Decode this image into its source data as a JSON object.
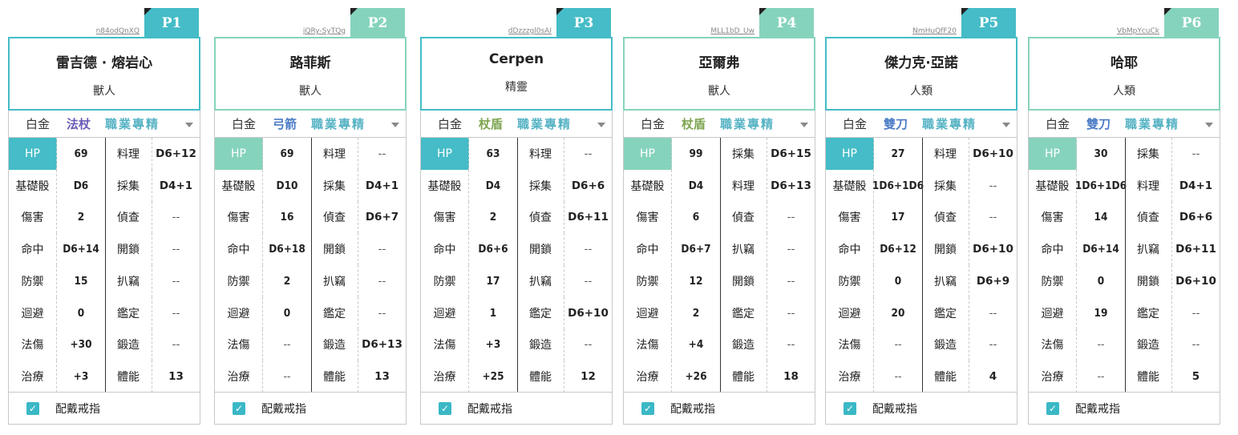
{
  "colors": {
    "teal": "#45bcc7",
    "mint": "#86d3bd",
    "purple": "#6a5ab6",
    "blue": "#4b7bc6",
    "olive": "#7da44e",
    "prof": "#56b3c4"
  },
  "ring_label": "配戴戒指",
  "players": [
    {
      "tab": "P1",
      "code": "n84odQnXQ",
      "name": "雷吉德 · 熔岩心",
      "race": "獸人",
      "tier": "白金",
      "weapon": "法杖",
      "weapon_color": "purple",
      "profession": "職業專精",
      "accent": "teal",
      "stats": [
        {
          "label": "HP",
          "value": "69"
        },
        {
          "label": "基礎骰",
          "value": "D6"
        },
        {
          "label": "傷害",
          "value": "2"
        },
        {
          "label": "命中",
          "value": "D6+14"
        },
        {
          "label": "防禦",
          "value": "15"
        },
        {
          "label": "迴避",
          "value": "0"
        },
        {
          "label": "法傷",
          "value": "+30"
        },
        {
          "label": "治療",
          "value": "+3"
        }
      ],
      "skills": [
        {
          "label": "料理",
          "value": "D6+12"
        },
        {
          "label": "採集",
          "value": "D4+1"
        },
        {
          "label": "偵查",
          "value": "--"
        },
        {
          "label": "開鎖",
          "value": "--"
        },
        {
          "label": "扒竊",
          "value": "--"
        },
        {
          "label": "鑑定",
          "value": "--"
        },
        {
          "label": "鍛造",
          "value": "--"
        },
        {
          "label": "體能",
          "value": "13"
        }
      ]
    },
    {
      "tab": "P2",
      "code": "jQRy-SyTQg",
      "name": "路菲斯",
      "race": "獸人",
      "tier": "白金",
      "weapon": "弓箭",
      "weapon_color": "blue",
      "profession": "職業專精",
      "accent": "mint",
      "stats": [
        {
          "label": "HP",
          "value": "69"
        },
        {
          "label": "基礎骰",
          "value": "D10"
        },
        {
          "label": "傷害",
          "value": "16"
        },
        {
          "label": "命中",
          "value": "D6+18"
        },
        {
          "label": "防禦",
          "value": "2"
        },
        {
          "label": "迴避",
          "value": "0"
        },
        {
          "label": "法傷",
          "value": "--"
        },
        {
          "label": "治療",
          "value": "--"
        }
      ],
      "skills": [
        {
          "label": "料理",
          "value": "--"
        },
        {
          "label": "採集",
          "value": "D4+1"
        },
        {
          "label": "偵查",
          "value": "D6+7"
        },
        {
          "label": "開鎖",
          "value": "--"
        },
        {
          "label": "扒竊",
          "value": "--"
        },
        {
          "label": "鑑定",
          "value": "--"
        },
        {
          "label": "鍛造",
          "value": "D6+13"
        },
        {
          "label": "體能",
          "value": "13"
        }
      ]
    },
    {
      "tab": "P3",
      "code": "dDzzzgl0sAI",
      "name": "Cerpen",
      "race": "精靈",
      "tier": "白金",
      "weapon": "杖盾",
      "weapon_color": "olive",
      "profession": "職業專精",
      "accent": "teal",
      "stats": [
        {
          "label": "HP",
          "value": "63"
        },
        {
          "label": "基礎骰",
          "value": "D4"
        },
        {
          "label": "傷害",
          "value": "2"
        },
        {
          "label": "命中",
          "value": "D6+6"
        },
        {
          "label": "防禦",
          "value": "17"
        },
        {
          "label": "迴避",
          "value": "1"
        },
        {
          "label": "法傷",
          "value": "+3"
        },
        {
          "label": "治療",
          "value": "+25"
        }
      ],
      "skills": [
        {
          "label": "料理",
          "value": "--"
        },
        {
          "label": "採集",
          "value": "D6+6"
        },
        {
          "label": "偵查",
          "value": "D6+11"
        },
        {
          "label": "開鎖",
          "value": "--"
        },
        {
          "label": "扒竊",
          "value": "--"
        },
        {
          "label": "鑑定",
          "value": "D6+10"
        },
        {
          "label": "鍛造",
          "value": "--"
        },
        {
          "label": "體能",
          "value": "12"
        }
      ]
    },
    {
      "tab": "P4",
      "code": "MLL1bD_Uw",
      "name": "亞爾弗",
      "race": "獸人",
      "tier": "白金",
      "weapon": "杖盾",
      "weapon_color": "olive",
      "profession": "職業專精",
      "accent": "mint",
      "stats": [
        {
          "label": "HP",
          "value": "99"
        },
        {
          "label": "基礎骰",
          "value": "D4"
        },
        {
          "label": "傷害",
          "value": "6"
        },
        {
          "label": "命中",
          "value": "D6+7"
        },
        {
          "label": "防禦",
          "value": "12"
        },
        {
          "label": "迴避",
          "value": "2"
        },
        {
          "label": "法傷",
          "value": "+4"
        },
        {
          "label": "治療",
          "value": "+26"
        }
      ],
      "skills": [
        {
          "label": "採集",
          "value": "D6+15"
        },
        {
          "label": "料理",
          "value": "D6+13"
        },
        {
          "label": "偵查",
          "value": "--"
        },
        {
          "label": "扒竊",
          "value": "--"
        },
        {
          "label": "開鎖",
          "value": "--"
        },
        {
          "label": "鑑定",
          "value": "--"
        },
        {
          "label": "鍛造",
          "value": "--"
        },
        {
          "label": "體能",
          "value": "18"
        }
      ]
    },
    {
      "tab": "P5",
      "code": "NmHuQfF20",
      "name": "傑力克·亞諾",
      "race": "人類",
      "tier": "白金",
      "weapon": "雙刀",
      "weapon_color": "blue",
      "profession": "職業專精",
      "accent": "teal",
      "stats": [
        {
          "label": "HP",
          "value": "27"
        },
        {
          "label": "基礎骰",
          "value": "1D6+1D6"
        },
        {
          "label": "傷害",
          "value": "17"
        },
        {
          "label": "命中",
          "value": "D6+12"
        },
        {
          "label": "防禦",
          "value": "0"
        },
        {
          "label": "迴避",
          "value": "20"
        },
        {
          "label": "法傷",
          "value": "--"
        },
        {
          "label": "治療",
          "value": "--"
        }
      ],
      "skills": [
        {
          "label": "料理",
          "value": "D6+10"
        },
        {
          "label": "採集",
          "value": "--"
        },
        {
          "label": "偵查",
          "value": "--"
        },
        {
          "label": "開鎖",
          "value": "D6+10"
        },
        {
          "label": "扒竊",
          "value": "D6+9"
        },
        {
          "label": "鑑定",
          "value": "--"
        },
        {
          "label": "鍛造",
          "value": "--"
        },
        {
          "label": "體能",
          "value": "4"
        }
      ]
    },
    {
      "tab": "P6",
      "code": "VbMpYcuCk",
      "name": "哈耶",
      "race": "人類",
      "tier": "白金",
      "weapon": "雙刀",
      "weapon_color": "blue",
      "profession": "職業專精",
      "accent": "mint",
      "stats": [
        {
          "label": "HP",
          "value": "30"
        },
        {
          "label": "基礎骰",
          "value": "1D6+1D6"
        },
        {
          "label": "傷害",
          "value": "14"
        },
        {
          "label": "命中",
          "value": "D6+14"
        },
        {
          "label": "防禦",
          "value": "0"
        },
        {
          "label": "迴避",
          "value": "19"
        },
        {
          "label": "法傷",
          "value": "--"
        },
        {
          "label": "治療",
          "value": "--"
        }
      ],
      "skills": [
        {
          "label": "採集",
          "value": "--"
        },
        {
          "label": "料理",
          "value": "D4+1"
        },
        {
          "label": "偵查",
          "value": "D6+6"
        },
        {
          "label": "扒竊",
          "value": "D6+11"
        },
        {
          "label": "開鎖",
          "value": "D6+10"
        },
        {
          "label": "鑑定",
          "value": "--"
        },
        {
          "label": "鍛造",
          "value": "--"
        },
        {
          "label": "體能",
          "value": "5"
        }
      ]
    }
  ]
}
